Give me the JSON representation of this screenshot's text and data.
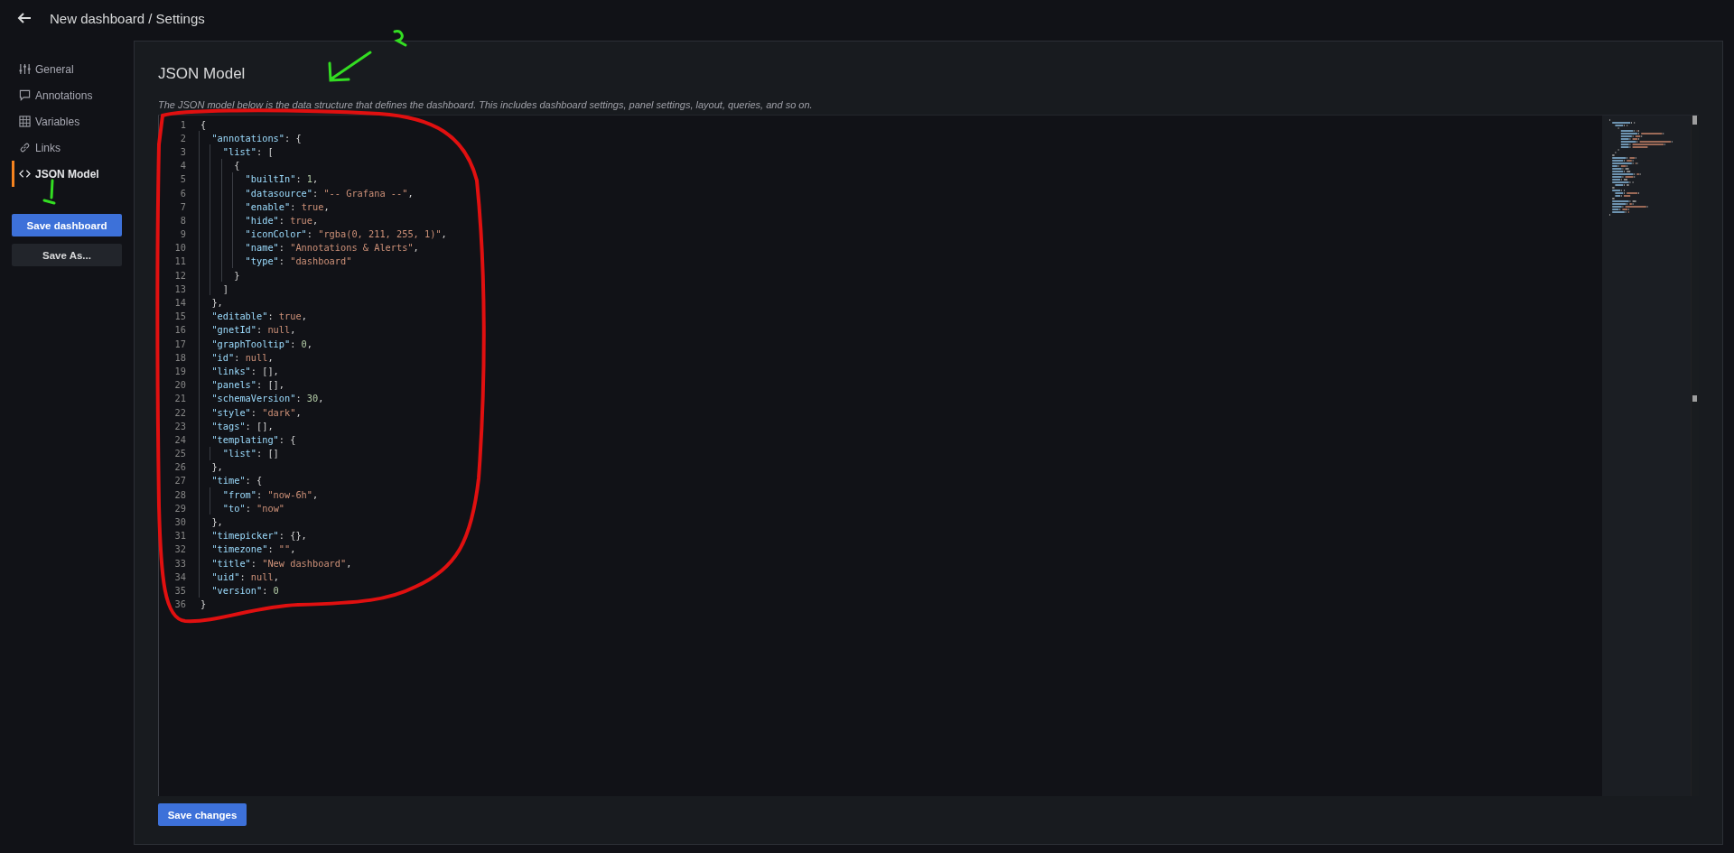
{
  "header": {
    "title": "New dashboard / Settings"
  },
  "sidebar": {
    "items": [
      {
        "label": "General",
        "selected": false
      },
      {
        "label": "Annotations",
        "selected": false
      },
      {
        "label": "Variables",
        "selected": false
      },
      {
        "label": "Links",
        "selected": false
      },
      {
        "label": "JSON Model",
        "selected": true
      }
    ],
    "buttons": [
      {
        "label": "Save dashboard",
        "kind": "primary"
      },
      {
        "label": "Save As...",
        "kind": "secondary"
      }
    ]
  },
  "panel": {
    "title": "JSON Model",
    "description": "The JSON model below is the data structure that defines the dashboard. This includes dashboard settings, panel settings, layout, queries, and so on.",
    "editor": {
      "lines": [
        {
          "number": "1",
          "text": "{"
        },
        {
          "number": "2",
          "text": "  \"annotations\": {"
        },
        {
          "number": "3",
          "text": "    \"list\": ["
        },
        {
          "number": "4",
          "text": "      {"
        },
        {
          "number": "5",
          "text": "        \"builtIn\": 1,"
        },
        {
          "number": "6",
          "text": "        \"datasource\": \"-- Grafana --\","
        },
        {
          "number": "7",
          "text": "        \"enable\": true,"
        },
        {
          "number": "8",
          "text": "        \"hide\": true,"
        },
        {
          "number": "9",
          "text": "        \"iconColor\": \"rgba(0, 211, 255, 1)\","
        },
        {
          "number": "10",
          "text": "        \"name\": \"Annotations & Alerts\","
        },
        {
          "number": "11",
          "text": "        \"type\": \"dashboard\""
        },
        {
          "number": "12",
          "text": "      }"
        },
        {
          "number": "13",
          "text": "    ]"
        },
        {
          "number": "14",
          "text": "  },"
        },
        {
          "number": "15",
          "text": "  \"editable\": true,"
        },
        {
          "number": "16",
          "text": "  \"gnetId\": null,"
        },
        {
          "number": "17",
          "text": "  \"graphTooltip\": 0,"
        },
        {
          "number": "18",
          "text": "  \"id\": null,"
        },
        {
          "number": "19",
          "text": "  \"links\": [],"
        },
        {
          "number": "20",
          "text": "  \"panels\": [],"
        },
        {
          "number": "21",
          "text": "  \"schemaVersion\": 30,"
        },
        {
          "number": "22",
          "text": "  \"style\": \"dark\","
        },
        {
          "number": "23",
          "text": "  \"tags\": [],"
        },
        {
          "number": "24",
          "text": "  \"templating\": {"
        },
        {
          "number": "25",
          "text": "    \"list\": []"
        },
        {
          "number": "26",
          "text": "  },"
        },
        {
          "number": "27",
          "text": "  \"time\": {"
        },
        {
          "number": "28",
          "text": "    \"from\": \"now-6h\","
        },
        {
          "number": "29",
          "text": "    \"to\": \"now\""
        },
        {
          "number": "30",
          "text": "  },"
        },
        {
          "number": "31",
          "text": "  \"timepicker\": {},"
        },
        {
          "number": "32",
          "text": "  \"timezone\": \"\","
        },
        {
          "number": "33",
          "text": "  \"title\": \"New dashboard\","
        },
        {
          "number": "34",
          "text": "  \"uid\": null,"
        },
        {
          "number": "35",
          "text": "  \"version\": 0"
        },
        {
          "number": "36",
          "text": "}"
        }
      ]
    },
    "button": {
      "label": "Save changes"
    }
  }
}
